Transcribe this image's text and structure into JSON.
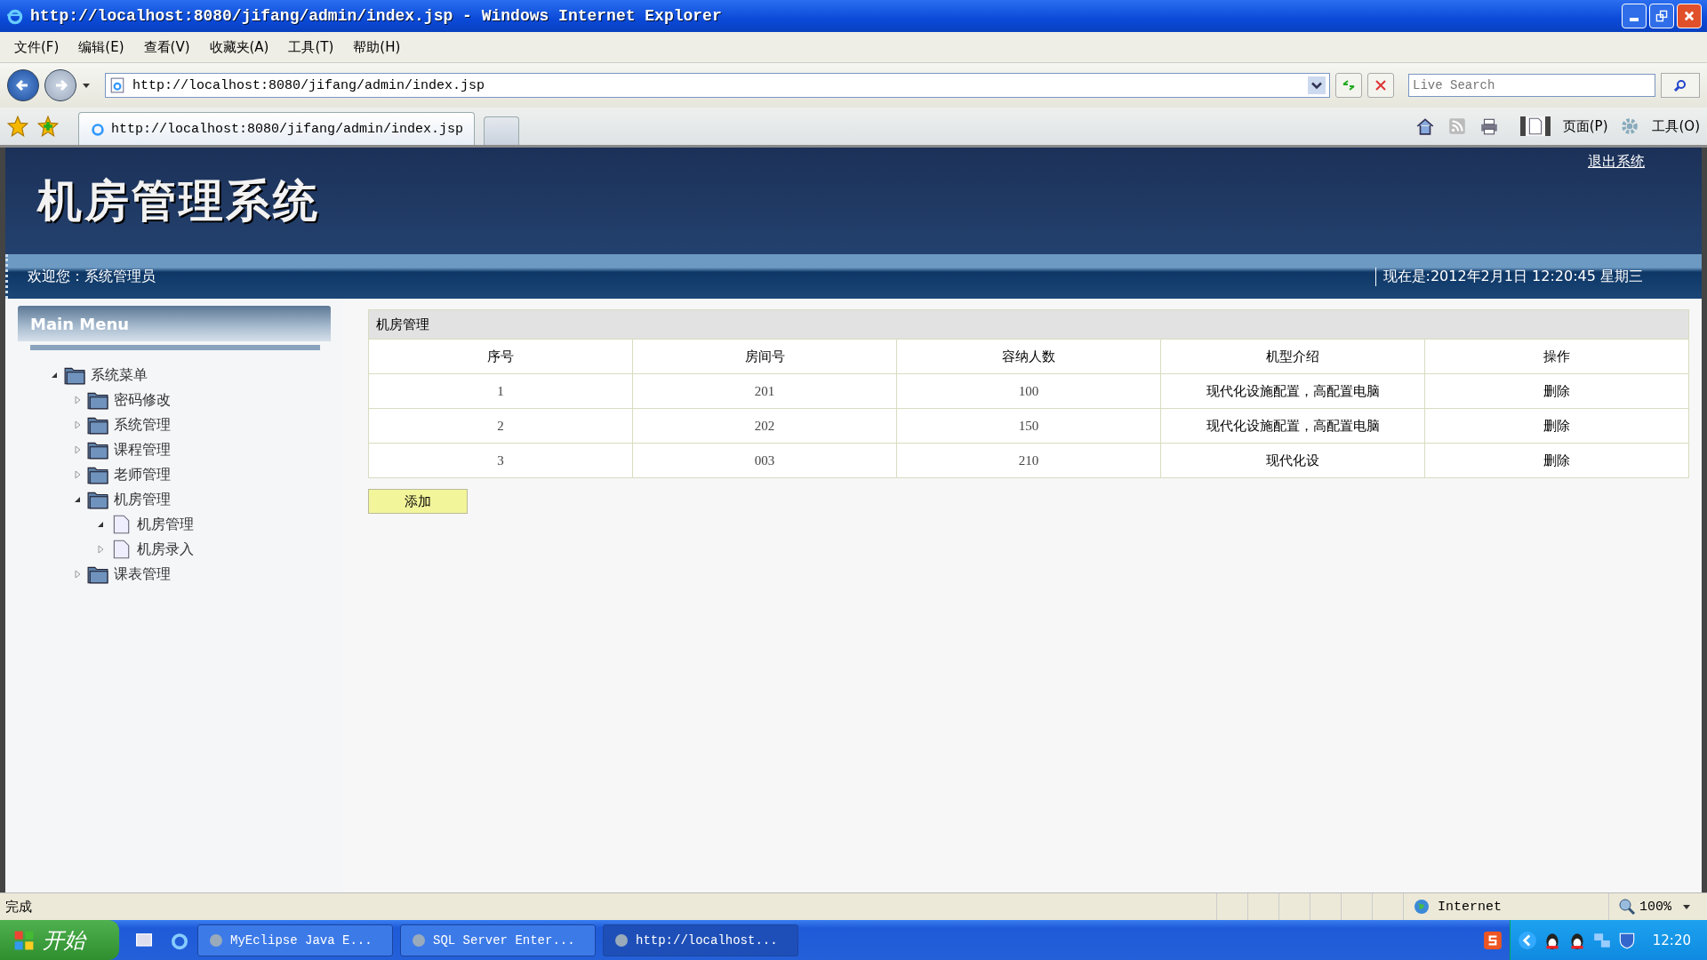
{
  "window": {
    "title": "http://localhost:8080/jifang/admin/index.jsp - Windows Internet Explorer"
  },
  "menu": [
    "文件(F)",
    "编辑(E)",
    "查看(V)",
    "收藏夹(A)",
    "工具(T)",
    "帮助(H)"
  ],
  "address": {
    "value": "http://localhost:8080/jifang/admin/index.jsp"
  },
  "search": {
    "placeholder": "Live Search"
  },
  "tabs": [
    {
      "label": "http://localhost:8080/jifang/admin/index.jsp",
      "selected": true
    }
  ],
  "command_bar": {
    "page": "页面(P)",
    "tools": "工具(O)"
  },
  "page": {
    "title": "机房管理系统",
    "logout": "退出系统",
    "welcome": "欢迎您：系统管理员",
    "datetime": "现在是:2012年2月1日  12:20:45 星期三"
  },
  "sidebar": {
    "title": "Main Menu",
    "tree": [
      {
        "label": "系统菜单",
        "kind": "folder",
        "expanded": true,
        "children": [
          {
            "label": "密码修改",
            "kind": "folder",
            "expanded": false
          },
          {
            "label": "系统管理",
            "kind": "folder",
            "expanded": false
          },
          {
            "label": "课程管理",
            "kind": "folder",
            "expanded": false
          },
          {
            "label": "老师管理",
            "kind": "folder",
            "expanded": false
          },
          {
            "label": "机房管理",
            "kind": "folder",
            "expanded": true,
            "children": [
              {
                "label": "机房管理",
                "kind": "page",
                "expanded": true
              },
              {
                "label": "机房录入",
                "kind": "page",
                "expanded": false
              }
            ]
          },
          {
            "label": "课表管理",
            "kind": "folder",
            "expanded": false
          }
        ]
      }
    ]
  },
  "table": {
    "title": "机房管理",
    "columns": [
      "序号",
      "房间号",
      "容纳人数",
      "机型介绍",
      "操作"
    ],
    "rows": [
      [
        "1",
        "201",
        "100",
        "现代化设施配置，高配置电脑",
        "删除"
      ],
      [
        "2",
        "202",
        "150",
        "现代化设施配置，高配置电脑",
        "删除"
      ],
      [
        "3",
        "003",
        "210",
        "现代化设",
        "删除"
      ]
    ]
  },
  "add_button": "添加",
  "status_bar": {
    "text": "完成",
    "zone": "Internet",
    "zoom": "100%"
  },
  "taskbar": {
    "start": "开始",
    "tasks": [
      {
        "label": "MyEclipse Java E...",
        "selected": false
      },
      {
        "label": "SQL Server Enter...",
        "selected": false
      },
      {
        "label": "http://localhost...",
        "selected": true
      }
    ],
    "clock": "12:20"
  }
}
